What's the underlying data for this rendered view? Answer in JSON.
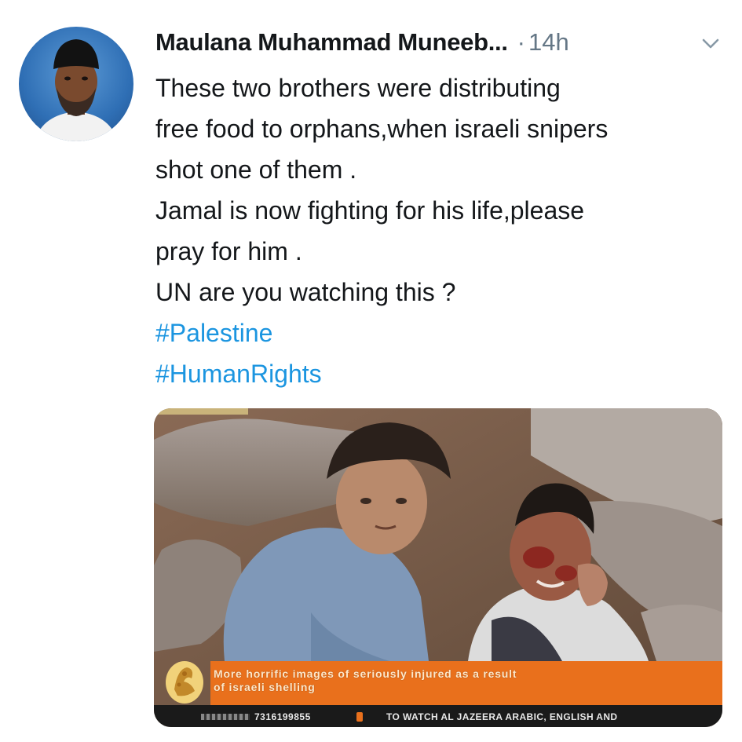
{
  "author": {
    "display_name": "Maulana Muhammad Muneeb...",
    "separator": "·",
    "timestamp": "14h"
  },
  "tweet": {
    "lines": [
      "These two brothers were distributing",
      "free food to orphans,when israeli snipers",
      "shot one of them .",
      "Jamal is now fighting for his life,please",
      "pray for him .",
      "UN are you watching this ?"
    ],
    "hashtags": [
      "#Palestine",
      "#HumanRights"
    ]
  },
  "media": {
    "ticker_line_1": "More horrific images of seriously injured as a result",
    "ticker_line_2": "of israeli shelling",
    "bottom_number": "7316199855",
    "bottom_text": "TO WATCH AL JAZEERA ARABIC, ENGLISH AND"
  },
  "colors": {
    "hashtag": "#1b95e0",
    "muted": "#657786",
    "ticker": "#e9701c"
  },
  "icons": {
    "menu": "chevron-down-icon",
    "broadcaster": "al-jazeera-logo-icon"
  }
}
